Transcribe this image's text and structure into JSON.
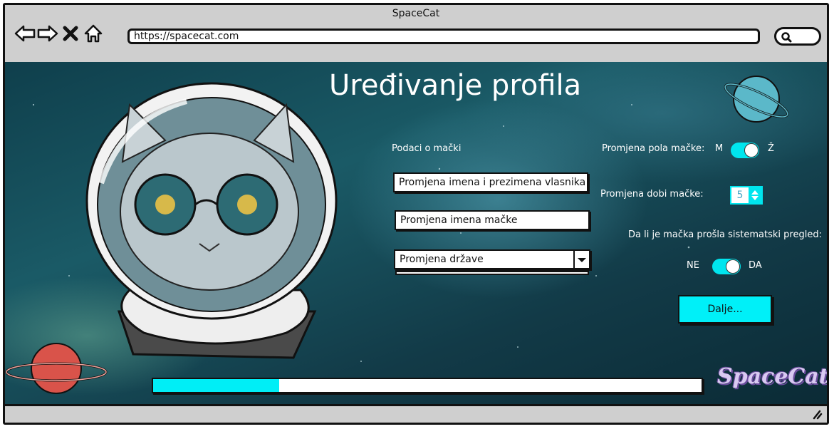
{
  "window": {
    "title": "SpaceCat",
    "url": "https://spacecat.com"
  },
  "page": {
    "heading": "Uređivanje profila",
    "section_label": "Podaci o mački",
    "owner_name_field": "Promjena imena i prezimena vlasnika",
    "cat_name_field": "Promjena imena mačke",
    "country_select": "Promjena države",
    "gender_label": "Promjena pola mačke:",
    "gender_left": "M",
    "gender_right": "Ž",
    "age_label": "Promjena dobi mačke:",
    "age_value": "5",
    "checkup_label": "Da li je mačka prošla sistematski pregled:",
    "checkup_no": "NE",
    "checkup_yes": "DA",
    "next_button": "Dalje...",
    "progress": 0.23,
    "logo_text": "SpaceCat"
  },
  "colors": {
    "accent": "#00eef6",
    "text": "#ffffff"
  },
  "icons": [
    "back-arrow-icon",
    "forward-arrow-icon",
    "close-icon",
    "home-icon",
    "search-icon",
    "resize-grip-icon",
    "dropdown-arrow-icon"
  ]
}
